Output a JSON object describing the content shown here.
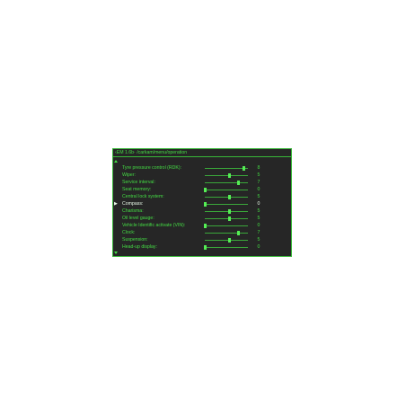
{
  "window": {
    "title": "‹EM 1.6b· /carkam/menu/operation"
  },
  "slider_max": 9,
  "settings": [
    {
      "label": "Tyre pressure control (RDK):",
      "value": "8",
      "selected": false
    },
    {
      "label": "Wiper:",
      "value": "5",
      "selected": false
    },
    {
      "label": "Service interval:",
      "value": "7",
      "selected": false
    },
    {
      "label": "Seat memory:",
      "value": "0",
      "selected": false
    },
    {
      "label": "Central lock system:",
      "value": "5",
      "selected": false
    },
    {
      "label": "Compass:",
      "value": "0",
      "selected": true
    },
    {
      "label": "Charisma:",
      "value": "5",
      "selected": false
    },
    {
      "label": "Oil level gauge:",
      "value": "5",
      "selected": false
    },
    {
      "label": "Vehicle Identific activate (VIN):",
      "value": "0",
      "selected": false
    },
    {
      "label": "Clock:",
      "value": "7",
      "selected": false
    },
    {
      "label": "Suspension:",
      "value": "5",
      "selected": false
    },
    {
      "label": "Head-up display:",
      "value": "0",
      "selected": false
    }
  ],
  "icons": {
    "scroll_up": "triangle-up-icon",
    "scroll_down": "triangle-down-icon",
    "selection_pointer": "triangle-right-icon"
  },
  "colors": {
    "background": "#262626",
    "text": "#44dd44",
    "border": "#38b838",
    "selected_text": "#e8f8e8"
  }
}
